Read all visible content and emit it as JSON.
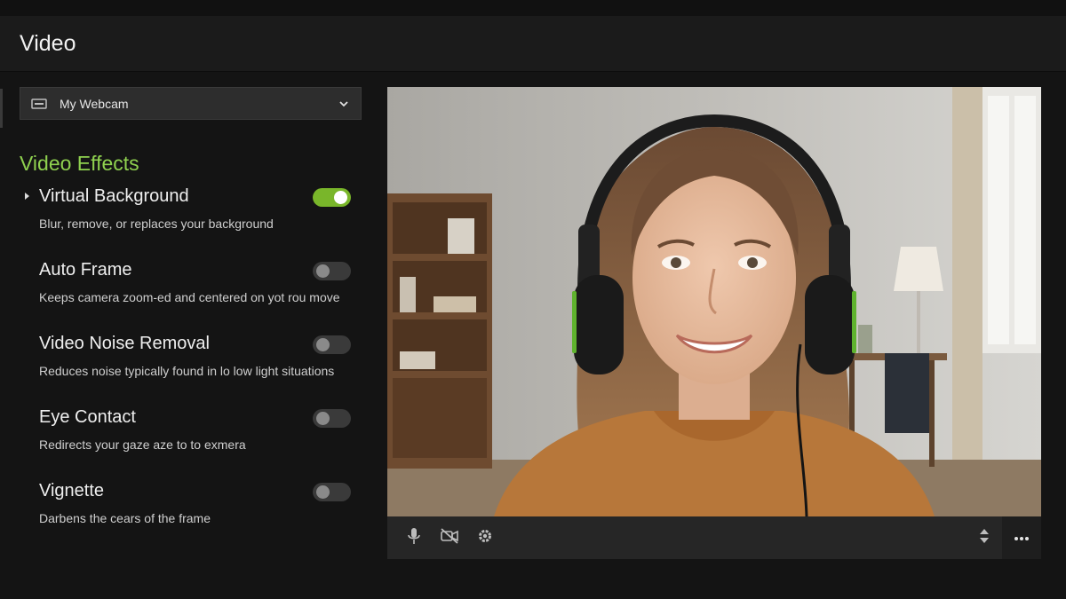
{
  "header": {
    "title": "Video"
  },
  "camera": {
    "selected": "My Webcam",
    "icon": "webcam-icon"
  },
  "effects": {
    "title": "Video Effects",
    "items": [
      {
        "name": "Virtual Background",
        "desc": "Blur, remove, or replaces your background",
        "enabled": true,
        "expandable": true
      },
      {
        "name": "Auto Frame",
        "desc": "Keeps camera zoom-ed and centered on yot rou move",
        "enabled": false
      },
      {
        "name": "Video Noise Removal",
        "desc": "Reduces noise typically found in lo low light situations",
        "enabled": false
      },
      {
        "name": "Eye Contact",
        "desc": "Redirects your gaze aze to to exmera",
        "enabled": false
      },
      {
        "name": "Vignette",
        "desc": "Darbens the cears of the frame",
        "enabled": false
      }
    ]
  },
  "controls": {
    "icons": [
      "microphone-icon",
      "camera-off-icon",
      "gear-icon",
      "sort-arrows-icon",
      "more-icon"
    ]
  },
  "colors": {
    "accent": "#8fd14f",
    "toggle_on": "#79b62a",
    "background": "#141414"
  }
}
